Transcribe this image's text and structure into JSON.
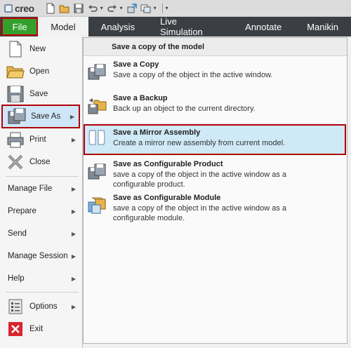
{
  "app": {
    "logo_text": "creo"
  },
  "qat": {
    "icons": [
      "new-icon",
      "open-icon",
      "save-icon",
      "undo-icon",
      "redo-icon",
      "regenerate-icon",
      "windows-icon",
      "more-icon"
    ]
  },
  "tabs": {
    "file": "File",
    "model": "Model",
    "items": [
      "Analysis",
      "Live Simulation",
      "Annotate",
      "Manikin"
    ]
  },
  "file_menu": {
    "items": [
      {
        "label": "New",
        "icon": "new-document-icon"
      },
      {
        "label": "Open",
        "icon": "open-folder-icon"
      },
      {
        "label": "Save",
        "icon": "save-icon"
      },
      {
        "label": "Save As",
        "icon": "save-as-icon",
        "has_submenu": true
      },
      {
        "label": "Print",
        "icon": "print-icon",
        "has_submenu": true
      },
      {
        "label": "Close",
        "icon": "close-icon"
      }
    ],
    "text_items": [
      {
        "label": "Manage File",
        "has_submenu": true
      },
      {
        "label": "Prepare",
        "has_submenu": true
      },
      {
        "label": "Send",
        "has_submenu": true
      },
      {
        "label": "Manage Session",
        "has_submenu": true
      },
      {
        "label": "Help",
        "has_submenu": true
      }
    ],
    "options": {
      "label": "Options",
      "icon": "options-icon",
      "has_submenu": true
    },
    "exit": {
      "label": "Exit",
      "icon": "exit-icon"
    }
  },
  "submenu": {
    "header": "Save a copy of the model",
    "items": [
      {
        "title": "Save a Copy",
        "desc": "Save a copy of the object in the active window.",
        "icon": "save-copy-icon"
      },
      {
        "title": "Save a Backup",
        "desc": "Back up an object to the current directory.",
        "icon": "save-backup-icon"
      },
      {
        "title": "Save a Mirror Assembly",
        "desc": "Create a mirror new assembly from current model.",
        "icon": "mirror-assembly-icon"
      },
      {
        "title": "Save as Configurable Product",
        "desc_lines": [
          "save a copy of the object in the active window as a",
          "configurable product."
        ],
        "icon": "configurable-product-icon"
      },
      {
        "title": "Save as Configurable Module",
        "desc_lines": [
          "save a copy of the object in the active window as a",
          "configurable module."
        ],
        "icon": "configurable-module-icon"
      }
    ]
  },
  "colors": {
    "file_tab": "#33a02c",
    "highlight_border": "#b0000a",
    "tab_bar": "#3b3f43",
    "selection": "#cfe6f8"
  }
}
